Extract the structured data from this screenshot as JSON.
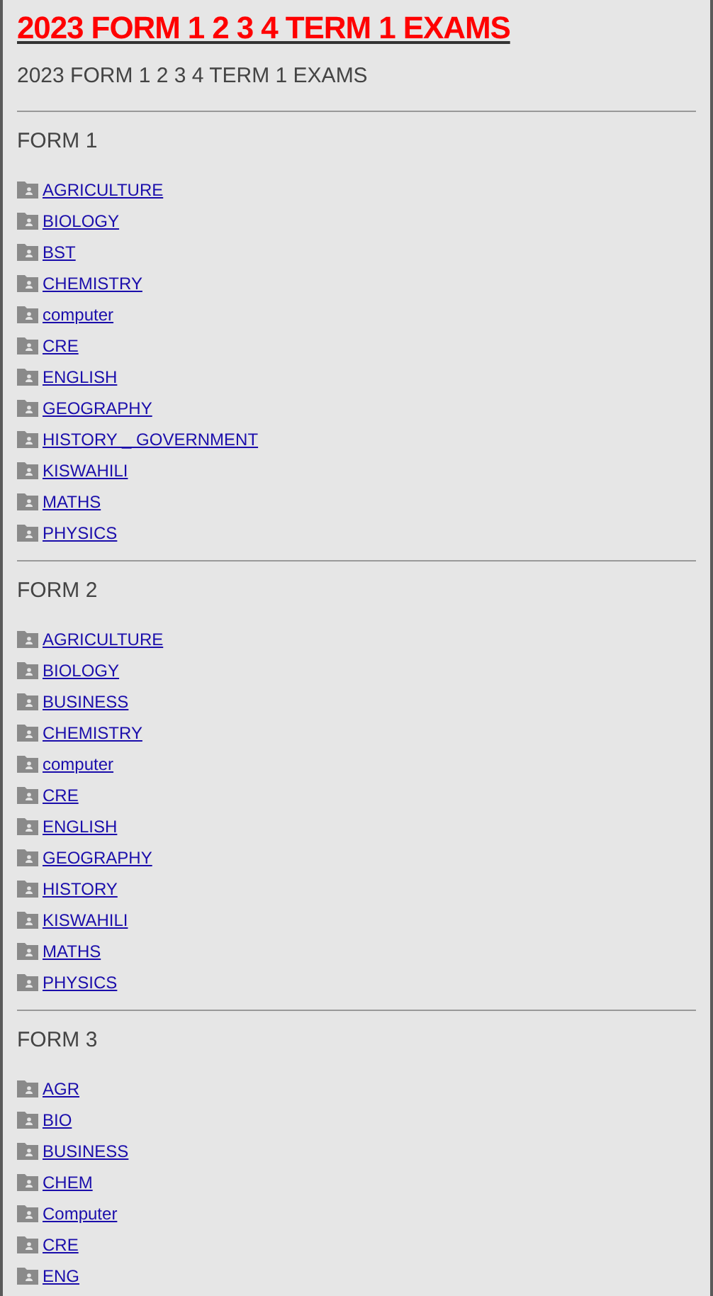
{
  "title": "2023 FORM 1 2 3 4 TERM 1 EXAMS",
  "subtitle": "2023 FORM 1 2 3 4 TERM 1 EXAMS",
  "sections": [
    {
      "heading": "FORM 1",
      "items": [
        "AGRICULTURE",
        "BIOLOGY",
        "BST",
        "CHEMISTRY",
        "computer",
        "CRE",
        "ENGLISH",
        "GEOGRAPHY",
        "HISTORY _ GOVERNMENT",
        "KISWAHILI",
        "MATHS",
        "PHYSICS"
      ]
    },
    {
      "heading": "FORM 2",
      "items": [
        "AGRICULTURE",
        "BIOLOGY",
        "BUSINESS",
        "CHEMISTRY",
        "computer",
        "CRE",
        "ENGLISH",
        "GEOGRAPHY",
        "HISTORY",
        "KISWAHILI",
        "MATHS",
        "PHYSICS"
      ]
    },
    {
      "heading": "FORM 3",
      "items": [
        "AGR",
        "BIO",
        "BUSINESS",
        "CHEM",
        "Computer",
        "CRE",
        "ENG"
      ]
    }
  ]
}
